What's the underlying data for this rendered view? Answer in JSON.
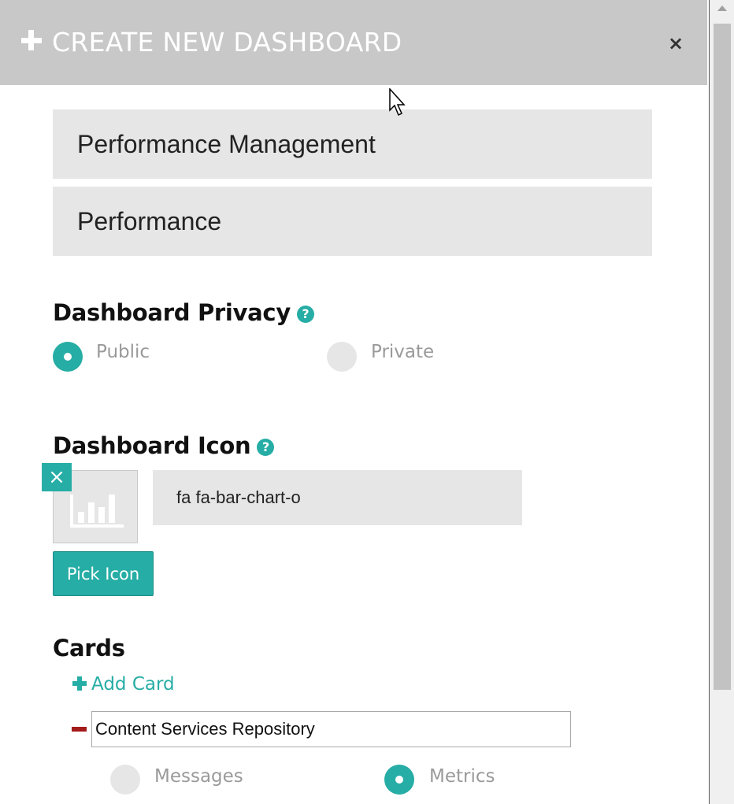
{
  "header": {
    "title": "CREATE NEW DASHBOARD",
    "close_label": "×"
  },
  "fields": {
    "dashboard_name": "Performance Management",
    "dashboard_short_name": "Performance"
  },
  "privacy": {
    "heading": "Dashboard Privacy",
    "help": "?",
    "options": [
      {
        "label": "Public",
        "checked": true
      },
      {
        "label": "Private",
        "checked": false
      }
    ]
  },
  "icon_section": {
    "heading": "Dashboard Icon",
    "help": "?",
    "remove_label": "×",
    "icon_class": "fa fa-bar-chart-o",
    "pick_label": "Pick Icon",
    "preview_icon": "bar-chart-icon"
  },
  "cards": {
    "heading": "Cards",
    "add_label": "Add Card",
    "items": [
      {
        "name": "Content Services Repository",
        "options": [
          {
            "label": "Messages",
            "checked": false
          },
          {
            "label": "Metrics",
            "checked": true
          }
        ]
      }
    ]
  },
  "colors": {
    "accent": "#26ada5",
    "header_bg": "#c8c8c8",
    "field_bg": "#e6e6e6",
    "remove": "#a31b1b"
  }
}
